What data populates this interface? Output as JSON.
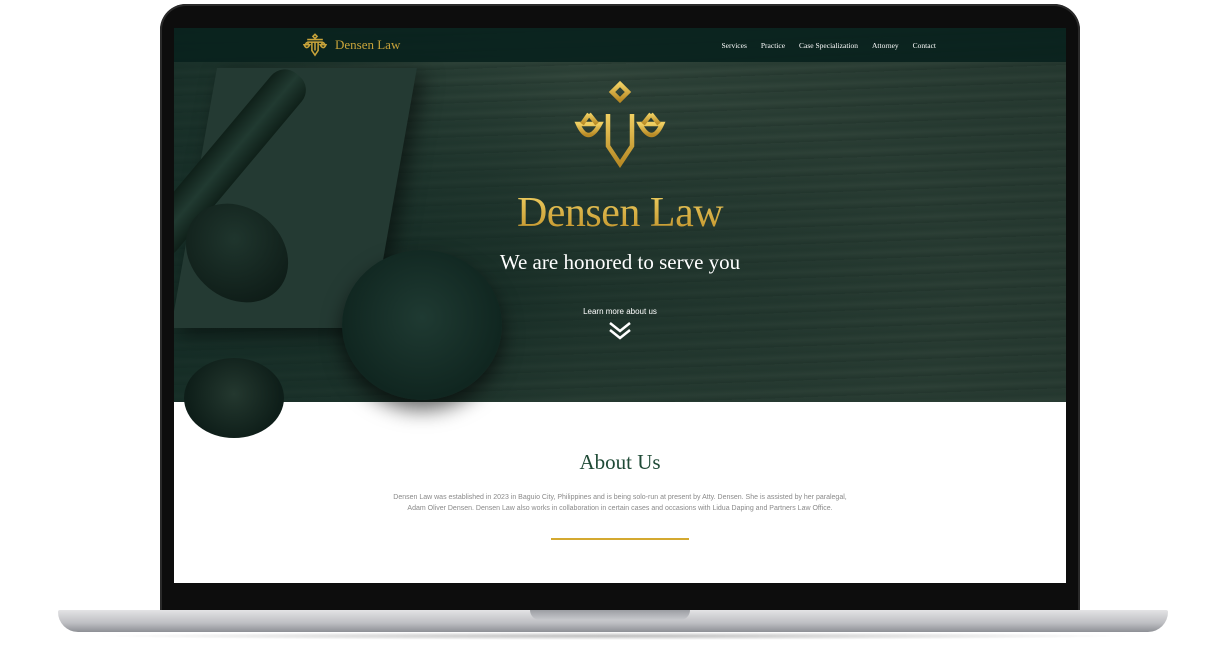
{
  "nav": {
    "brand": "Densen Law",
    "links": [
      "Services",
      "Practice",
      "Case Specialization",
      "Attorney",
      "Contact"
    ]
  },
  "hero": {
    "title": "Densen Law",
    "tagline": "We are honored to serve you",
    "cta": "Learn more about us"
  },
  "about": {
    "title": "About Us",
    "text": "Densen Law was established in 2023 in Baguio City, Philippines and is being solo-run at present by Atty. Densen. She is assisted by her paralegal, Adam Oliver Densen. Densen Law also works in collaboration in certain cases and occasions with Lidua Daping and Partners Law Office."
  },
  "icons": {
    "logo": "scales-of-justice-icon",
    "scroll": "double-chevron-down-icon"
  },
  "colors": {
    "gold": "#d0a83a",
    "nav_bg": "#09221d",
    "heading_green": "#1f4a36",
    "body_text": "#8a8a8a"
  }
}
